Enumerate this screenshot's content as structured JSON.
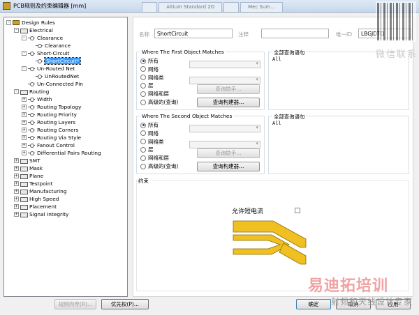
{
  "window": {
    "title": "PCB规则及约束编辑器 [mm]",
    "tabs": [
      "",
      "Altium Standard 2D",
      "",
      "Mec Sum..."
    ]
  },
  "tree": [
    {
      "label": "Design Rules",
      "level": 0,
      "exp": "-",
      "icon": "root"
    },
    {
      "label": "Electrical",
      "level": 1,
      "exp": "-",
      "icon": "cat"
    },
    {
      "label": "Clearance",
      "level": 2,
      "exp": "-",
      "icon": "rule"
    },
    {
      "label": "Clearance",
      "level": 3,
      "exp": "",
      "icon": "rule"
    },
    {
      "label": "Short-Circuit",
      "level": 2,
      "exp": "-",
      "icon": "rule"
    },
    {
      "label": "ShortCircuit*",
      "level": 3,
      "exp": "",
      "icon": "rule",
      "selected": true
    },
    {
      "label": "Un-Routed Net",
      "level": 2,
      "exp": "-",
      "icon": "rule"
    },
    {
      "label": "UnRoutedNet",
      "level": 3,
      "exp": "",
      "icon": "rule"
    },
    {
      "label": "Un-Connected Pin",
      "level": 2,
      "exp": "",
      "icon": "rule"
    },
    {
      "label": "Routing",
      "level": 1,
      "exp": "-",
      "icon": "cat"
    },
    {
      "label": "Width",
      "level": 2,
      "exp": "+",
      "icon": "rule"
    },
    {
      "label": "Routing Topology",
      "level": 2,
      "exp": "+",
      "icon": "rule"
    },
    {
      "label": "Routing Priority",
      "level": 2,
      "exp": "+",
      "icon": "rule"
    },
    {
      "label": "Routing Layers",
      "level": 2,
      "exp": "+",
      "icon": "rule"
    },
    {
      "label": "Routing Corners",
      "level": 2,
      "exp": "+",
      "icon": "rule"
    },
    {
      "label": "Routing Via Style",
      "level": 2,
      "exp": "+",
      "icon": "rule"
    },
    {
      "label": "Fanout Control",
      "level": 2,
      "exp": "+",
      "icon": "rule"
    },
    {
      "label": "Differential Pairs Routing",
      "level": 2,
      "exp": "+",
      "icon": "rule"
    },
    {
      "label": "SMT",
      "level": 1,
      "exp": "+",
      "icon": "cat"
    },
    {
      "label": "Mask",
      "level": 1,
      "exp": "+",
      "icon": "cat"
    },
    {
      "label": "Plane",
      "level": 1,
      "exp": "+",
      "icon": "cat"
    },
    {
      "label": "Testpoint",
      "level": 1,
      "exp": "+",
      "icon": "cat"
    },
    {
      "label": "Manufacturing",
      "level": 1,
      "exp": "+",
      "icon": "cat"
    },
    {
      "label": "High Speed",
      "level": 1,
      "exp": "+",
      "icon": "cat"
    },
    {
      "label": "Placement",
      "level": 1,
      "exp": "+",
      "icon": "cat"
    },
    {
      "label": "Signal Integrity",
      "level": 1,
      "exp": "+",
      "icon": "cat"
    }
  ],
  "rule": {
    "name_label": "名称",
    "name_value": "ShortCircuit",
    "comment_label": "注释",
    "comment_value": "",
    "id_label": "唯一ID",
    "id_value": "LBGJDTQ"
  },
  "first_match": {
    "title": "Where The First Object Matches",
    "options": [
      "所有",
      "网络",
      "网络类",
      "层",
      "网络和层",
      "高级的(查询)"
    ],
    "selected_index": 0,
    "query_helper": "查询助手...",
    "query_builder": "查询构建器...",
    "full_query_title": "全部查询语句",
    "full_query": "All"
  },
  "second_match": {
    "title": "Where The Second Object Matches",
    "options": [
      "所有",
      "网络",
      "网络类",
      "层",
      "网络和层",
      "高级的(查询)"
    ],
    "selected_index": 0,
    "query_helper": "查询助手...",
    "query_builder": "查询构建器...",
    "full_query_title": "全部查询语句",
    "full_query": "All"
  },
  "constraints": {
    "title": "约束",
    "allow_short_label": "允许短电流",
    "allow_short_checked": false,
    "trace_color": "#f0c020"
  },
  "buttons": {
    "rule_wizard": "规则向导(R)...",
    "priorities": "优先权(P)...",
    "ok": "确定",
    "cancel": "取消",
    "apply": "应用"
  },
  "watermarks": {
    "wechat": "微信联系",
    "brand": "易迪拓培训",
    "sub": "射频和天线设计专家"
  }
}
